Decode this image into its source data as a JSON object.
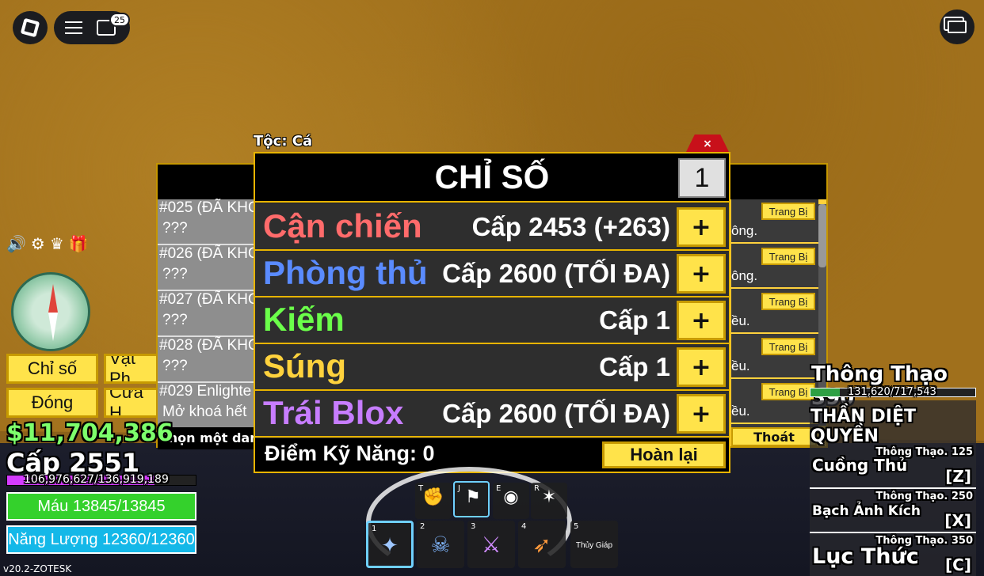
{
  "topbar": {
    "chat_badge": "25"
  },
  "left": {
    "buttons": [
      "Chỉ số",
      "Vật Ph",
      "Đóng",
      "Cửa H"
    ],
    "money": "$11,704,386",
    "level": "Cấp 2551",
    "xp_text": "106,976,627/136,919,189",
    "xp_fraction": 0.78,
    "health": "Máu 13845/13845",
    "energy": "Năng Lượng 12360/12360",
    "version": "v20.2-ZOTESK"
  },
  "race_label": "Tộc: Cá",
  "close_label": "×",
  "list": {
    "rows": [
      {
        "l1": "#025 (ĐÃ KHO",
        "l2": "???"
      },
      {
        "l1": "#026 (ĐÃ KHO",
        "l2": "???"
      },
      {
        "l1": "#027 (ĐÃ KHO",
        "l2": "???"
      },
      {
        "l1": "#028 (ĐÃ KHO",
        "l2": "???"
      },
      {
        "l1": "#029 Enlighte",
        "l2": "Mở khoá hết"
      }
    ],
    "choose": "Chọn một danh",
    "equip_label": "Trang Bị",
    "right_texts": [
      "ông.",
      "ông.",
      "ều.",
      "ều.",
      "ều."
    ],
    "exit_label": "Thoát"
  },
  "stats": {
    "title": "CHỈ SỐ",
    "points_input": "1",
    "rows": [
      {
        "name": "Cận chiến",
        "value": "Cấp 2453 (+263)",
        "color": "#ff6b6b"
      },
      {
        "name": "Phòng thủ",
        "value": "Cấp 2600 (TỐI ĐA)",
        "color": "#5a8bff"
      },
      {
        "name": "Kiếm",
        "value": "Cấp 1",
        "color": "#6bff4a"
      },
      {
        "name": "Súng",
        "value": "Cấp 1",
        "color": "#ffd23d"
      },
      {
        "name": "Trái Blox",
        "value": "Cấp 2600 (TỐI ĐA)",
        "color": "#c77dff"
      }
    ],
    "plus_label": "+",
    "skill_points": "Điểm Kỹ Năng: 0",
    "reset_label": "Hoàn lại"
  },
  "skills": {
    "title": "Thông Thạo 390",
    "xp_text": "131,620/717,543",
    "xp_fraction": 0.18,
    "style_name": "THẦN DIỆT QUYỀN",
    "moves": [
      {
        "req": "Thông Thạo. 125",
        "name": "Cuồng Thủ",
        "key": "[Z]"
      },
      {
        "req": "Thông Thạo. 250",
        "name": "Bạch Ảnh Kích",
        "key": "[X]"
      },
      {
        "req": "Thông Thạo. 350",
        "name": "Lục Thức",
        "key": "[C]"
      }
    ]
  },
  "hotbar": {
    "top_keys": [
      "T",
      "J",
      "E",
      "R"
    ],
    "slots": [
      "1",
      "2",
      "3",
      "4",
      "5"
    ],
    "slot5_label": "Thủy Giáp"
  }
}
